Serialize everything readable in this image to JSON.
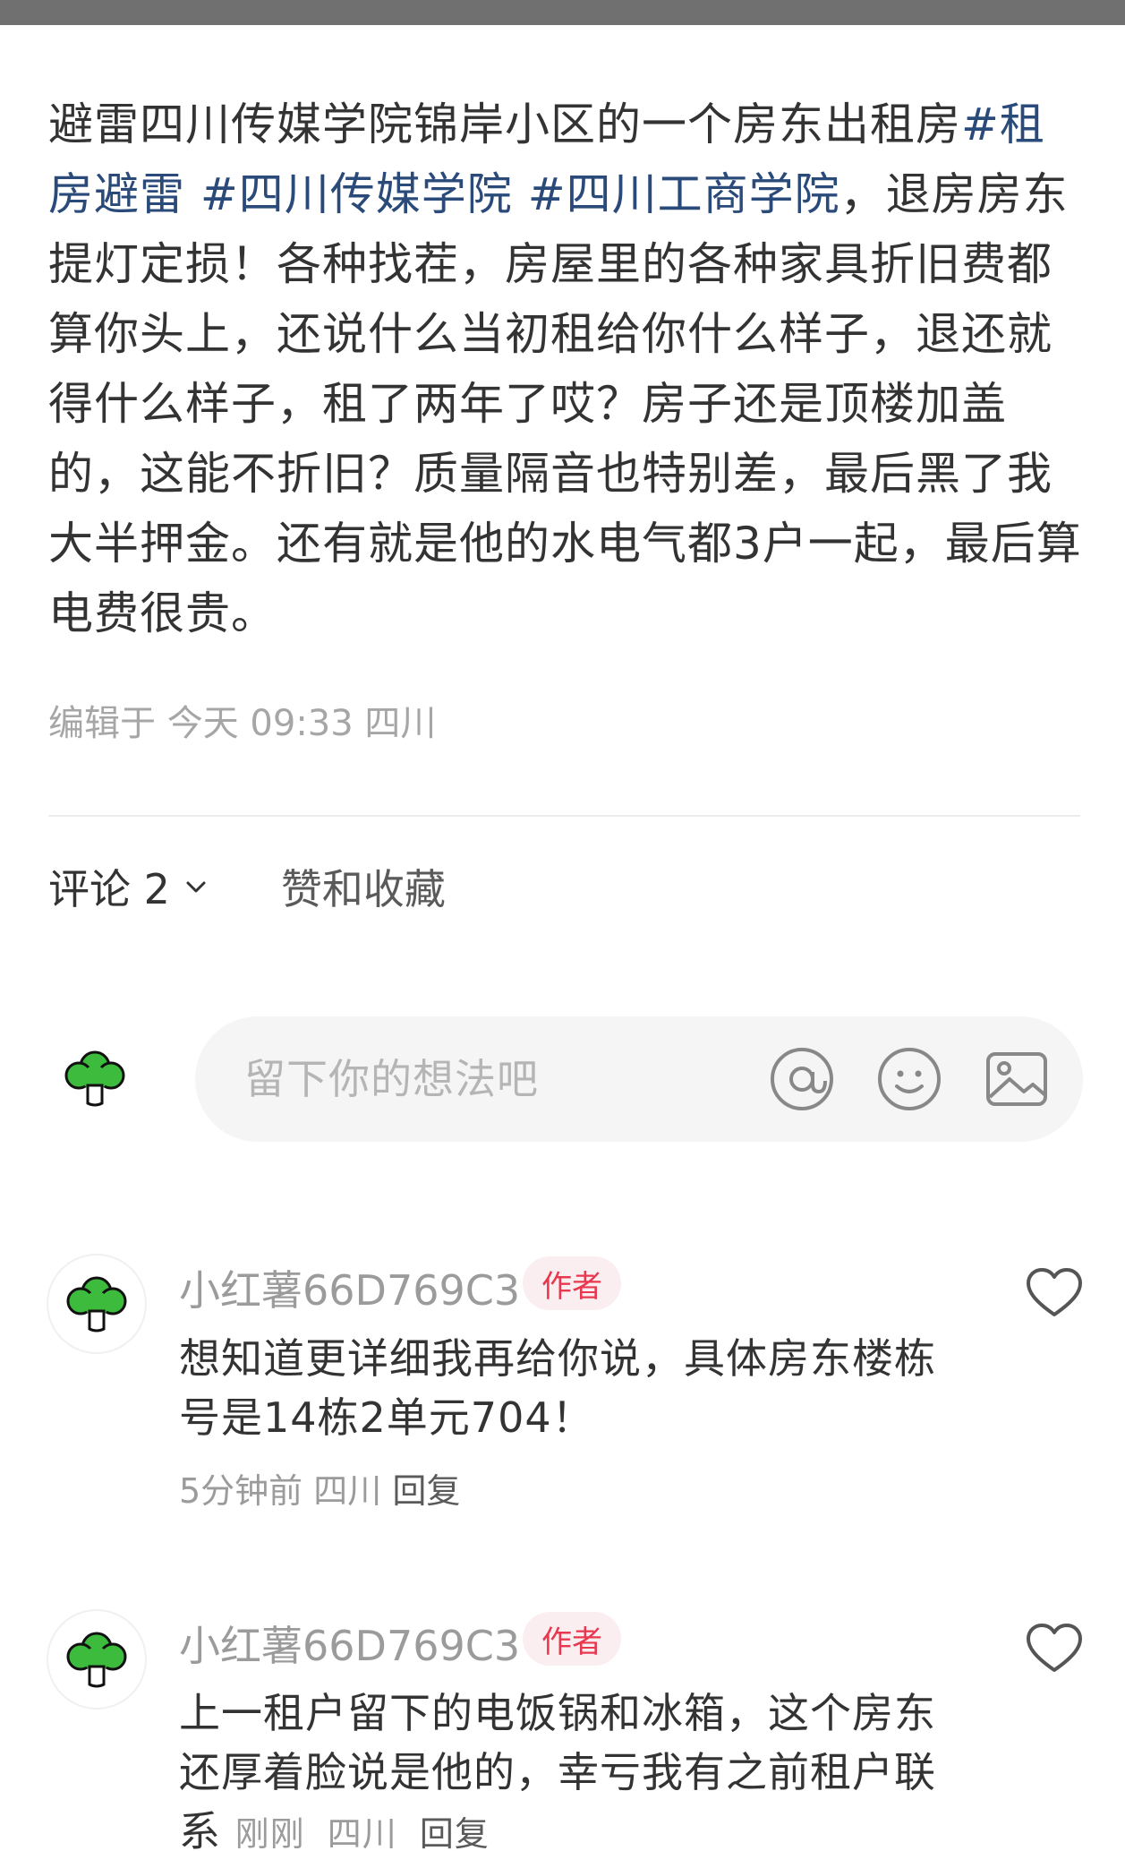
{
  "post": {
    "text_before": "避雷四川传媒学院锦岸小区的一个房东出租房",
    "tags": [
      "#租房避雷",
      "#四川传媒学院",
      "#四川工商学院"
    ],
    "text_after": "，退房房东提灯定损！各种找茬，房屋里的各种家具折旧费都算你头上，还说什么当初租给你什么样子，退还就得什么样子，租了两年了哎？房子还是顶楼加盖的，这能不折旧？质量隔音也特别差，最后黑了我大半押金。还有就是他的水电气都3户一起，最后算电费很贵。",
    "meta": "编辑于 今天 09:33 四川"
  },
  "tabs": {
    "comments_label": "评论 2",
    "likes_label": "赞和收藏"
  },
  "input": {
    "placeholder": "留下你的想法吧"
  },
  "comments": [
    {
      "author": "小红薯66D769C3",
      "badge": "作者",
      "text": "想知道更详细我再给你说，具体房东楼栋号是14栋2单元704！",
      "time": "5分钟前",
      "location": "四川",
      "reply": "回复"
    },
    {
      "author": "小红薯66D769C3",
      "badge": "作者",
      "text": "上一租户留下的电饭锅和冰箱，这个房东还厚着脸说是他的，幸亏我有之前租户联系",
      "time": "刚刚",
      "location": "四川",
      "reply": "回复"
    }
  ],
  "colors": {
    "tag": "#2a4a7a",
    "badge_text": "#e8384f",
    "badge_bg": "#fbeef0",
    "avatar_green": "#3dbb3d"
  },
  "icons": [
    "broccoli-avatar-icon",
    "at-icon",
    "emoji-icon",
    "image-icon",
    "heart-icon",
    "chevron-down-icon"
  ]
}
